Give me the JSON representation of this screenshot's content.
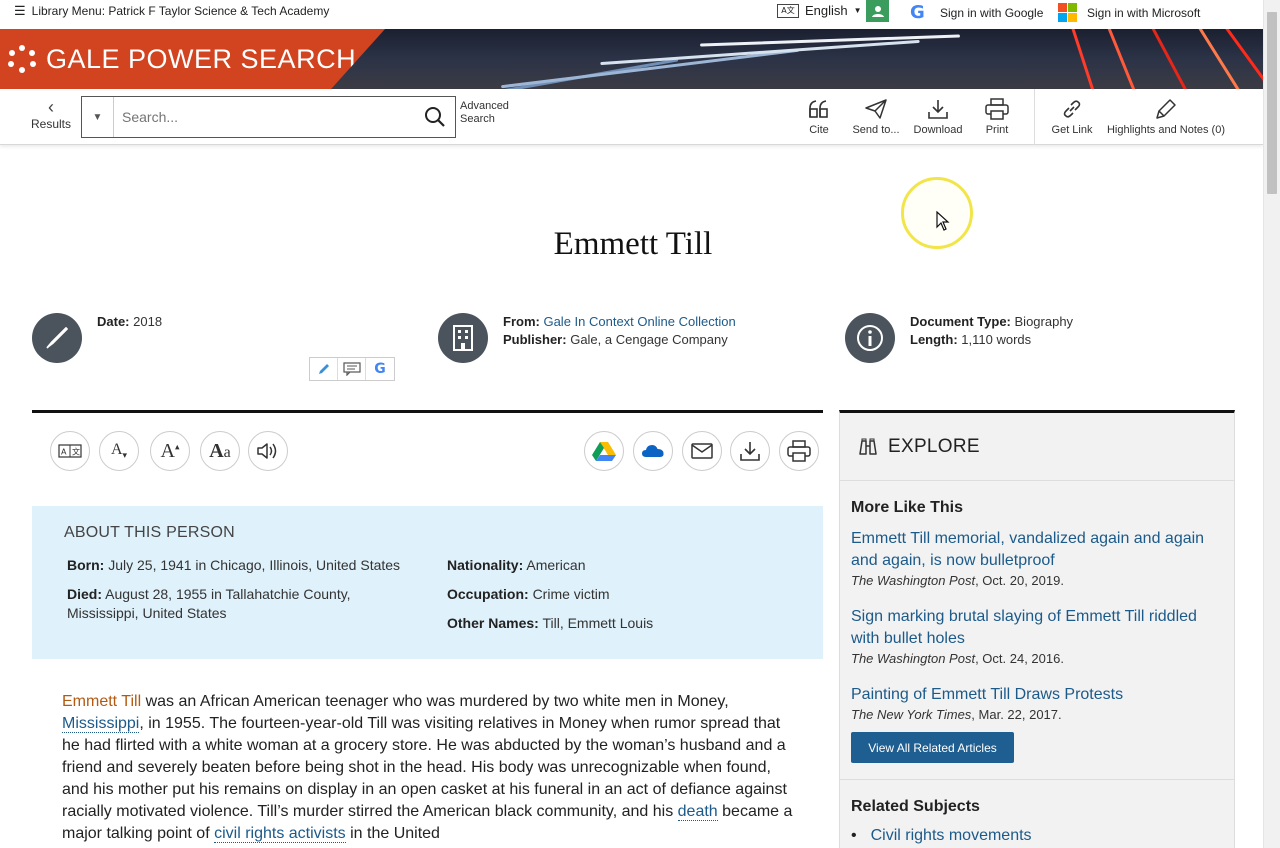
{
  "utilbar": {
    "menu_icon": "hamburger-icon",
    "library_menu": "Library Menu: Patrick F Taylor Science & Tech Academy",
    "language": "English",
    "sign_in_google": "Sign in with Google",
    "sign_in_microsoft": "Sign in with Microsoft"
  },
  "banner": {
    "brand": "GALE POWER SEARCH",
    "brand_color": "#d2431f"
  },
  "toolbar": {
    "results": "Results",
    "search_placeholder": "Search...",
    "advanced_search": "Advanced Search",
    "cite": "Cite",
    "send_to": "Send to...",
    "download": "Download",
    "print": "Print",
    "get_link": "Get Link",
    "highlights": "Highlights and Notes (0)"
  },
  "document": {
    "title": "Emmett Till",
    "date_label": "Date:",
    "date": "2018",
    "from_label": "From:",
    "from": "Gale In Context Online Collection",
    "publisher_label": "Publisher:",
    "publisher": "Gale, a Cengage Company",
    "doctype_label": "Document Type:",
    "doctype": "Biography",
    "length_label": "Length:",
    "length": "1,110 words"
  },
  "about": {
    "heading": "ABOUT THIS PERSON",
    "born_label": "Born:",
    "born": "July 25, 1941 in Chicago, Illinois, United States",
    "died_label": "Died:",
    "died_1": "August 28, 1955 in Tallahatchie County,",
    "died_2": "Mississippi, United States",
    "nationality_label": "Nationality:",
    "nationality": "American",
    "occupation_label": "Occupation:",
    "occupation": "Crime victim",
    "other_names_label": "Other Names:",
    "other_names": "Till, Emmett Louis"
  },
  "body": {
    "p1_link_name": "Emmett Till",
    "p1_a": " was an African American teenager who was murdered by two white men in Money, ",
    "p1_link_state": "Mississippi",
    "p1_b": ", in 1955. The fourteen-year-old Till was visiting relatives in Money when rumor spread that he had flirted with a white woman at a grocery store. He was abducted by the woman’s husband and a friend and severely beaten before being shot in the head. His body was unrecognizable when found, and his mother put his remains on display in an open casket at his funeral in an act of defiance against racially motivated violence. Till’s murder stirred the American black community, and his ",
    "p1_link_death": "death",
    "p1_c": " became a major talking point of ",
    "p1_link_activists": "civil rights activists",
    "p1_d": " in the United"
  },
  "explore": {
    "heading": "EXPLORE",
    "more_like_this": "More Like This",
    "items": [
      {
        "title": "Emmett Till memorial, vandalized again and again and again, is now bulletproof",
        "source": "The Washington Post",
        "date": ", Oct. 20, 2019."
      },
      {
        "title": "Sign marking brutal slaying of Emmett Till riddled with bullet holes",
        "source": "The Washington Post",
        "date": ", Oct. 24, 2016."
      },
      {
        "title": "Painting of Emmett Till Draws Protests",
        "source": "The New York Times",
        "date": ", Mar. 22, 2017."
      }
    ],
    "view_all": "View All Related Articles",
    "related_subjects": "Related Subjects",
    "subject_1": "Civil rights movements"
  }
}
